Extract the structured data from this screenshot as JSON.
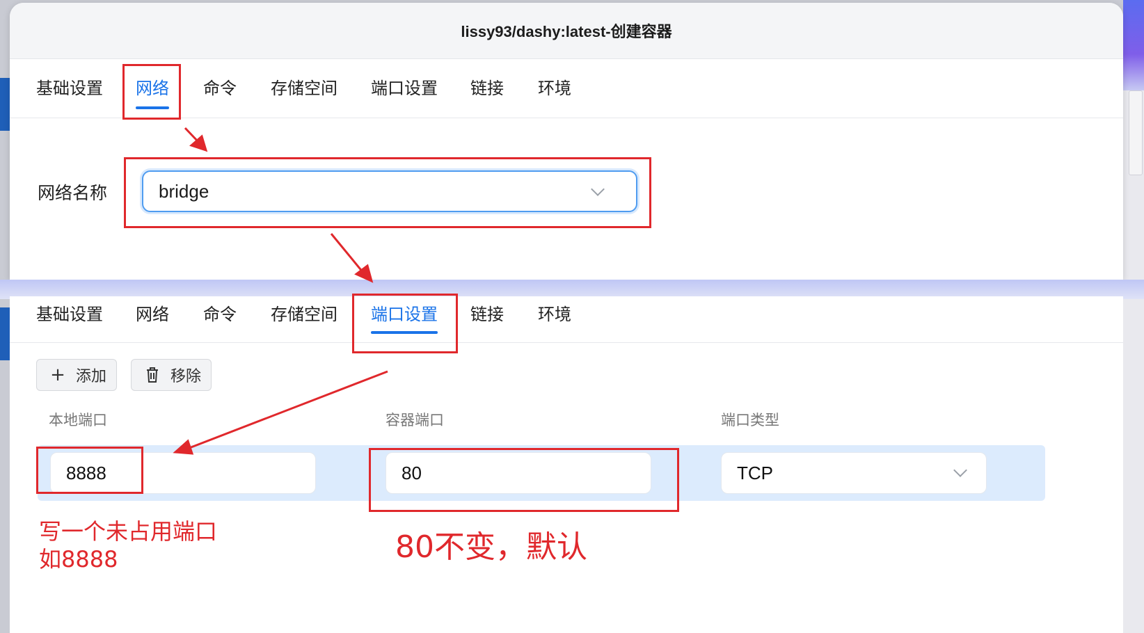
{
  "dialog": {
    "title": "lissy93/dashy:latest-创建容器"
  },
  "tabs_top": [
    {
      "label": "基础设置"
    },
    {
      "label": "网络"
    },
    {
      "label": "命令"
    },
    {
      "label": "存储空间"
    },
    {
      "label": "端口设置"
    },
    {
      "label": "链接"
    },
    {
      "label": "环境"
    }
  ],
  "tabs_bottom": [
    {
      "label": "基础设置"
    },
    {
      "label": "网络"
    },
    {
      "label": "命令"
    },
    {
      "label": "存储空间"
    },
    {
      "label": "端口设置"
    },
    {
      "label": "链接"
    },
    {
      "label": "环境"
    }
  ],
  "network": {
    "label": "网络名称",
    "selected": "bridge"
  },
  "ports": {
    "add_label": "添加",
    "remove_label": "移除",
    "headers": [
      "本地端口",
      "容器端口",
      "端口类型"
    ],
    "row": {
      "local": "8888",
      "container": "80",
      "type": "TCP"
    }
  },
  "annotations": {
    "note_local_line1": "写一个未占用端口",
    "note_local_line2": "如8888",
    "note_container": "80不变，默认"
  },
  "colors": {
    "accent": "#1a73e8",
    "annotation": "#e0282c",
    "row_highlight": "#dcebfd"
  },
  "icons": {
    "add": "plus-icon",
    "remove": "trash-icon",
    "dropdown": "chevron-down-icon"
  }
}
